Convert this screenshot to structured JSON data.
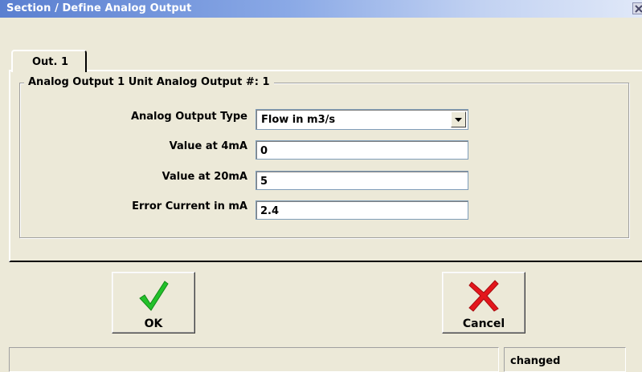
{
  "window": {
    "title": "Section / Define Analog Output"
  },
  "tabs": [
    {
      "label": "Out. 1"
    }
  ],
  "group": {
    "label": "Analog Output 1 Unit Analog Output #: 1"
  },
  "fields": {
    "output_type": {
      "label": "Analog Output Type",
      "value": "Flow in m3/s"
    },
    "value_4ma": {
      "label": "Value at 4mA",
      "value": "0"
    },
    "value_20ma": {
      "label": "Value at 20mA",
      "value": "5"
    },
    "error_current": {
      "label": "Error Current in mA",
      "value": "2.4"
    }
  },
  "buttons": {
    "ok": {
      "label": "OK",
      "icon": "checkmark-icon",
      "color": "#22c12a"
    },
    "cancel": {
      "label": "Cancel",
      "icon": "cross-icon",
      "color": "#e4161c"
    }
  },
  "statusbar": {
    "main": "",
    "state": "changed"
  }
}
